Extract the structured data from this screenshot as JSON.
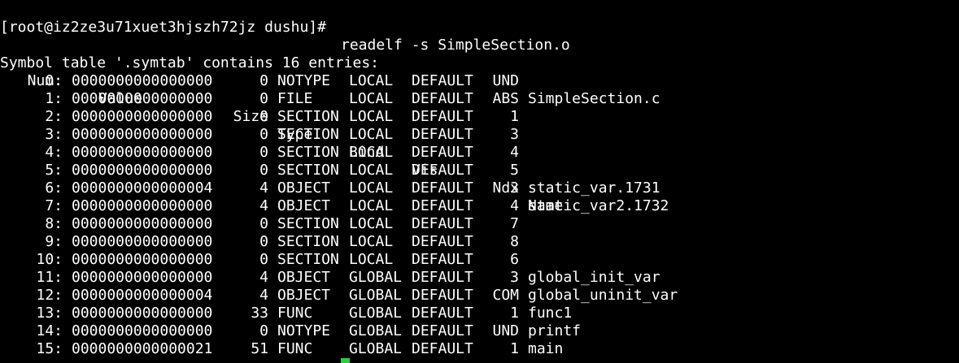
{
  "terminal": {
    "prompt": "[root@iz2ze3u71xuet3hjszh72jz dushu]# ",
    "command": "readelf -s SimpleSection.o",
    "summary": "Symbol table '.symtab' contains 16 entries:",
    "headers": {
      "num": "Num:",
      "value": "Value",
      "size": "Size",
      "type": "Type",
      "bind": "Bind",
      "vis": "Vis",
      "ndx": "Ndx",
      "name": "Name"
    },
    "rows": [
      {
        "num": "0:",
        "value": "0000000000000000",
        "size": "0",
        "type": "NOTYPE",
        "bind": "LOCAL",
        "vis": "DEFAULT",
        "ndx": "UND",
        "name": ""
      },
      {
        "num": "1:",
        "value": "0000000000000000",
        "size": "0",
        "type": "FILE",
        "bind": "LOCAL",
        "vis": "DEFAULT",
        "ndx": "ABS",
        "name": "SimpleSection.c"
      },
      {
        "num": "2:",
        "value": "0000000000000000",
        "size": "0",
        "type": "SECTION",
        "bind": "LOCAL",
        "vis": "DEFAULT",
        "ndx": "1",
        "name": ""
      },
      {
        "num": "3:",
        "value": "0000000000000000",
        "size": "0",
        "type": "SECTION",
        "bind": "LOCAL",
        "vis": "DEFAULT",
        "ndx": "3",
        "name": ""
      },
      {
        "num": "4:",
        "value": "0000000000000000",
        "size": "0",
        "type": "SECTION",
        "bind": "LOCAL",
        "vis": "DEFAULT",
        "ndx": "4",
        "name": ""
      },
      {
        "num": "5:",
        "value": "0000000000000000",
        "size": "0",
        "type": "SECTION",
        "bind": "LOCAL",
        "vis": "DEFAULT",
        "ndx": "5",
        "name": ""
      },
      {
        "num": "6:",
        "value": "0000000000000004",
        "size": "4",
        "type": "OBJECT",
        "bind": "LOCAL",
        "vis": "DEFAULT",
        "ndx": "3",
        "name": "static_var.1731"
      },
      {
        "num": "7:",
        "value": "0000000000000000",
        "size": "4",
        "type": "OBJECT",
        "bind": "LOCAL",
        "vis": "DEFAULT",
        "ndx": "4",
        "name": "static_var2.1732"
      },
      {
        "num": "8:",
        "value": "0000000000000000",
        "size": "0",
        "type": "SECTION",
        "bind": "LOCAL",
        "vis": "DEFAULT",
        "ndx": "7",
        "name": ""
      },
      {
        "num": "9:",
        "value": "0000000000000000",
        "size": "0",
        "type": "SECTION",
        "bind": "LOCAL",
        "vis": "DEFAULT",
        "ndx": "8",
        "name": ""
      },
      {
        "num": "10:",
        "value": "0000000000000000",
        "size": "0",
        "type": "SECTION",
        "bind": "LOCAL",
        "vis": "DEFAULT",
        "ndx": "6",
        "name": ""
      },
      {
        "num": "11:",
        "value": "0000000000000000",
        "size": "4",
        "type": "OBJECT",
        "bind": "GLOBAL",
        "vis": "DEFAULT",
        "ndx": "3",
        "name": "global_init_var"
      },
      {
        "num": "12:",
        "value": "0000000000000004",
        "size": "4",
        "type": "OBJECT",
        "bind": "GLOBAL",
        "vis": "DEFAULT",
        "ndx": "COM",
        "name": "global_uninit_var"
      },
      {
        "num": "13:",
        "value": "0000000000000000",
        "size": "33",
        "type": "FUNC",
        "bind": "GLOBAL",
        "vis": "DEFAULT",
        "ndx": "1",
        "name": "func1"
      },
      {
        "num": "14:",
        "value": "0000000000000000",
        "size": "0",
        "type": "NOTYPE",
        "bind": "GLOBAL",
        "vis": "DEFAULT",
        "ndx": "UND",
        "name": "printf"
      },
      {
        "num": "15:",
        "value": "0000000000000021",
        "size": "51",
        "type": "FUNC",
        "bind": "GLOBAL",
        "vis": "DEFAULT",
        "ndx": "1",
        "name": "main"
      }
    ],
    "colors": {
      "background": "#000000",
      "foreground": "#ffffff",
      "cursor": "#2ecc40"
    }
  }
}
